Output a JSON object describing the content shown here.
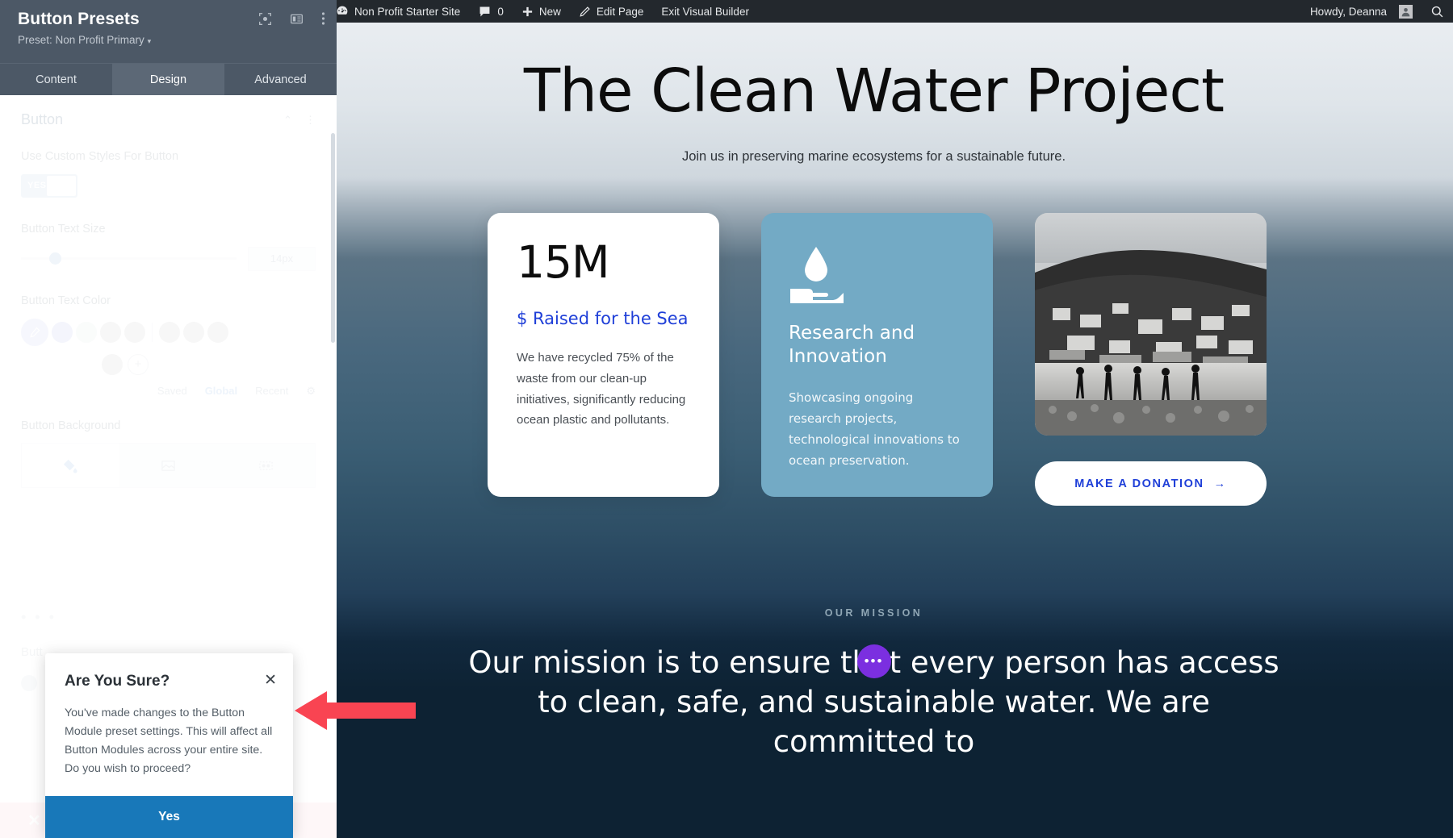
{
  "settings_panel": {
    "title": "Button Presets",
    "preset_label": "Preset: Non Profit Primary",
    "caret": "▾",
    "tabs": [
      {
        "label": "Content",
        "active": false
      },
      {
        "label": "Design",
        "active": true
      },
      {
        "label": "Advanced",
        "active": false
      }
    ],
    "section": {
      "title": "Button"
    },
    "fields": {
      "custom_styles_label": "Use Custom Styles For Button",
      "toggle_value": "YES",
      "text_size_label": "Button Text Size",
      "text_size_value": "14px",
      "text_color_label": "Button Text Color",
      "background_label": "Button Background",
      "palette_tabs": [
        "Saved",
        "Global",
        "Recent"
      ],
      "palette_active": "Global"
    },
    "ghost": {
      "dots": "• • •",
      "label": "Butt"
    }
  },
  "confirm_dialog": {
    "title": "Are You Sure?",
    "body": "You've made changes to the Button Module preset settings. This will affect all Button Modules across your entire site. Do you wish to proceed?",
    "confirm_label": "Yes",
    "close_icon": "✕"
  },
  "admin_bar": {
    "wp_logo": "wordpress-logo-icon",
    "site_name": "Non Profit Starter Site",
    "comment_count": "0",
    "new_label": "New",
    "edit_page_label": "Edit Page",
    "exit_builder_label": "Exit Visual Builder",
    "howdy": "Howdy, Deanna",
    "search_icon": "search-icon"
  },
  "page": {
    "hero": {
      "title": "The Clean Water Project",
      "subtitle": "Join us in preserving marine ecosystems for a sustainable future."
    },
    "cards": [
      {
        "type": "stat",
        "number": "15M",
        "label": "$ Raised for the Sea",
        "body": "We have recycled 75% of the waste from our clean-up initiatives, significantly reducing ocean plastic and pollutants."
      },
      {
        "type": "feature",
        "icon": "water-drop-in-hand-icon",
        "title": "Research and Innovation",
        "body": "Showcasing ongoing research projects, technological innovations to ocean preservation."
      },
      {
        "type": "photo",
        "image_alt": "coastal-village-photo",
        "button_label": "MAKE A DONATION",
        "button_arrow": "→"
      }
    ],
    "mission": {
      "eyebrow": "OUR MISSION",
      "text": "Our mission is to ensure that every person has access to clean, safe, and sustainable water. We are committed to",
      "fab_icon": "•••"
    }
  },
  "colors": {
    "panel_header": "#4c5866",
    "accent_blue": "#1878b9",
    "link_blue": "#1f3fd8",
    "card_blue": "#73aac5",
    "deep_navy": "#0d2233",
    "arrow_red": "#f94452",
    "purple": "#7b2fe0"
  }
}
